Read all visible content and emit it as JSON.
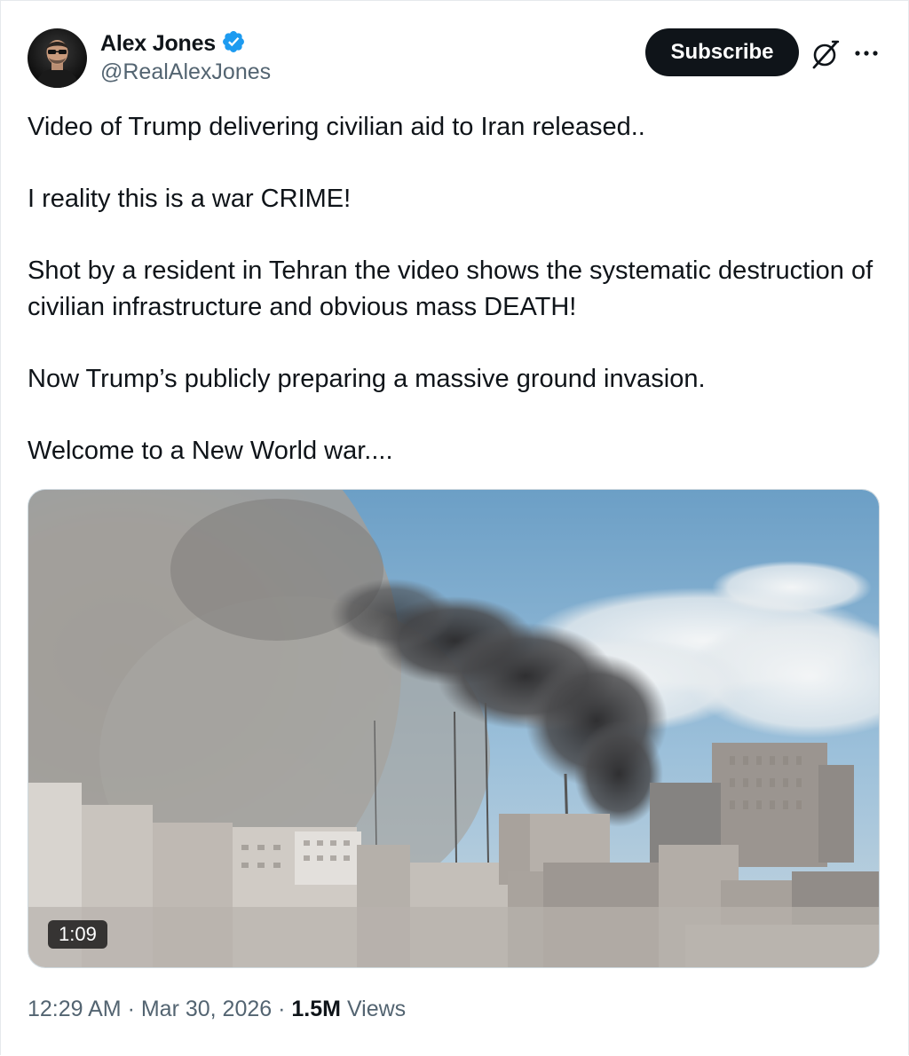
{
  "author": {
    "display_name": "Alex Jones",
    "handle": "@RealAlexJones",
    "verified": true,
    "verified_color": "#1d9bf0",
    "avatar_icon": "avatar-photo"
  },
  "actions": {
    "subscribe_label": "Subscribe",
    "grok_icon": "grok-icon",
    "more_icon": "more-icon"
  },
  "tweet": {
    "paragraphs": [
      "Video of Trump delivering civilian aid to Iran released..",
      "I reality this is a war CRIME!",
      "Shot  by a resident in Tehran the video shows the systematic destruction of civilian infrastructure and obvious mass DEATH!",
      "Now Trump’s publicly preparing a massive ground invasion.",
      "Welcome to a New World war...."
    ]
  },
  "media": {
    "type": "video",
    "duration": "1:09"
  },
  "meta": {
    "time": "12:29 AM",
    "separator": " · ",
    "date": "Mar 30, 2026",
    "views_count": "1.5M",
    "views_label": " Views"
  },
  "colors": {
    "text_primary": "#0f1419",
    "text_secondary": "#536471",
    "button_bg": "#0f1419",
    "border": "#e6e9ec"
  }
}
